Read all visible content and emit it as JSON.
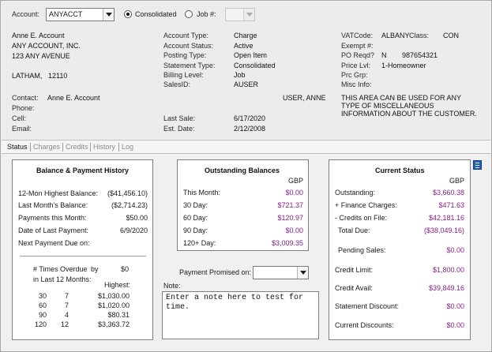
{
  "header": {
    "account_label": "Account:",
    "account_value": "ANYACCT",
    "consolidated_label": "Consolidated",
    "job_label": "Job #:"
  },
  "address": {
    "line1": "Anne E. Account",
    "line2": "ANY ACCOUNT, INC.",
    "line3": "123 ANY AVENUE",
    "city": "LATHAM,",
    "zip": "12110"
  },
  "contact": {
    "contact_label": "Contact:",
    "contact_value": "Anne E. Account",
    "phone_label": "Phone:",
    "cell_label": "Cell:",
    "email_label": "Email:"
  },
  "account_info": {
    "type_label": "Account Type:",
    "type_value": "Charge",
    "status_label": "Account Status:",
    "status_value": "Active",
    "posting_label": "Posting Type:",
    "posting_value": "Open Item",
    "statement_label": "Statement Type:",
    "statement_value": "Consolidated",
    "billing_label": "Billing Level:",
    "billing_value": "Job",
    "salesid_label": "SalesID:",
    "salesid_value": "AUSER",
    "user_value": "USER, ANNE",
    "last_sale_label": "Last Sale:",
    "last_sale_value": "6/17/2020",
    "est_date_label": "Est. Date:",
    "est_date_value": "2/12/2008"
  },
  "right_info": {
    "vat_label": "VATCode:",
    "vat_value": "ALBANY",
    "class_label": "Class:",
    "class_value": "CON",
    "exempt_label": "Exempt #:",
    "po_label": "PO Reqd?",
    "po_value": "N",
    "po_number": "987654321",
    "price_label": "Price Lvl:",
    "price_value": "1-Homeowner",
    "prc_grp_label": "Prc Grp:",
    "misc_label": "Misc Info:",
    "misc_text1": "THIS AREA CAN BE USED FOR ANY",
    "misc_text2": "TYPE OF MISCELLANEOUS",
    "misc_text3": "INFORMATION ABOUT THE CUSTOMER."
  },
  "tabs": [
    "Status",
    "Charges",
    "Credits",
    "History",
    "Log"
  ],
  "balance_history": {
    "title": "Balance & Payment History",
    "rows": [
      {
        "label": "12-Mon Highest Balance:",
        "value": "($41,456.10)"
      },
      {
        "label": "Last Month's Balance:",
        "value": "($2,714.23)"
      },
      {
        "label": "Payments this Month:",
        "value": "$50.00"
      },
      {
        "label": "Date of Last Payment:",
        "value": "6/9/2020"
      },
      {
        "label": "Next Payment Due on:",
        "value": ""
      }
    ],
    "overdue_label1": "# Times Overdue",
    "overdue_label2": "in Last 12 Months:",
    "by_label": "by",
    "by_value": "$0",
    "highest_label": "Highest:",
    "overdue_rows": [
      {
        "days": "30",
        "count": "7",
        "highest": "$1,030.00"
      },
      {
        "days": "60",
        "count": "7",
        "highest": "$1,020.00"
      },
      {
        "days": "90",
        "count": "4",
        "highest": "$80.31"
      },
      {
        "days": "120",
        "count": "12",
        "highest": "$3,363.72"
      }
    ]
  },
  "outstanding": {
    "title": "Outstanding Balances",
    "currency": "GBP",
    "rows": [
      {
        "label": "This Month:",
        "value": "$0.00"
      },
      {
        "label": "30 Day:",
        "value": "$721.37"
      },
      {
        "label": "60 Day:",
        "value": "$120.97"
      },
      {
        "label": "90 Day:",
        "value": "$0.00"
      },
      {
        "label": "120+ Day:",
        "value": "$3,009.35"
      }
    ],
    "payment_promised_label": "Payment Promised on:",
    "note_label": "Note:",
    "note_text": "Enter a note here to test for time."
  },
  "current_status": {
    "title": "Current Status",
    "currency": "GBP",
    "rows": [
      {
        "label": "Outstanding:",
        "value": "$3,660.38"
      },
      {
        "label": "+ Finance Charges:",
        "value": "$471.63"
      },
      {
        "label": "- Credits on File:",
        "value": "$42,181.16"
      },
      {
        "label": "Total Due:",
        "value": "($38,049.16)"
      },
      {
        "label": "Pending Sales:",
        "value": "$0.00"
      },
      {
        "label": "Credit Limit:",
        "value": "$1,800.00"
      },
      {
        "label": "Credit Avail:",
        "value": "$39,849.16"
      },
      {
        "label": "Statement Discount:",
        "value": "$0.00"
      },
      {
        "label": "Current Discounts:",
        "value": "$0.00"
      }
    ]
  },
  "colors": {
    "accent_purple": "#8a1d8a",
    "icon_blue": "#1d5fc5"
  }
}
